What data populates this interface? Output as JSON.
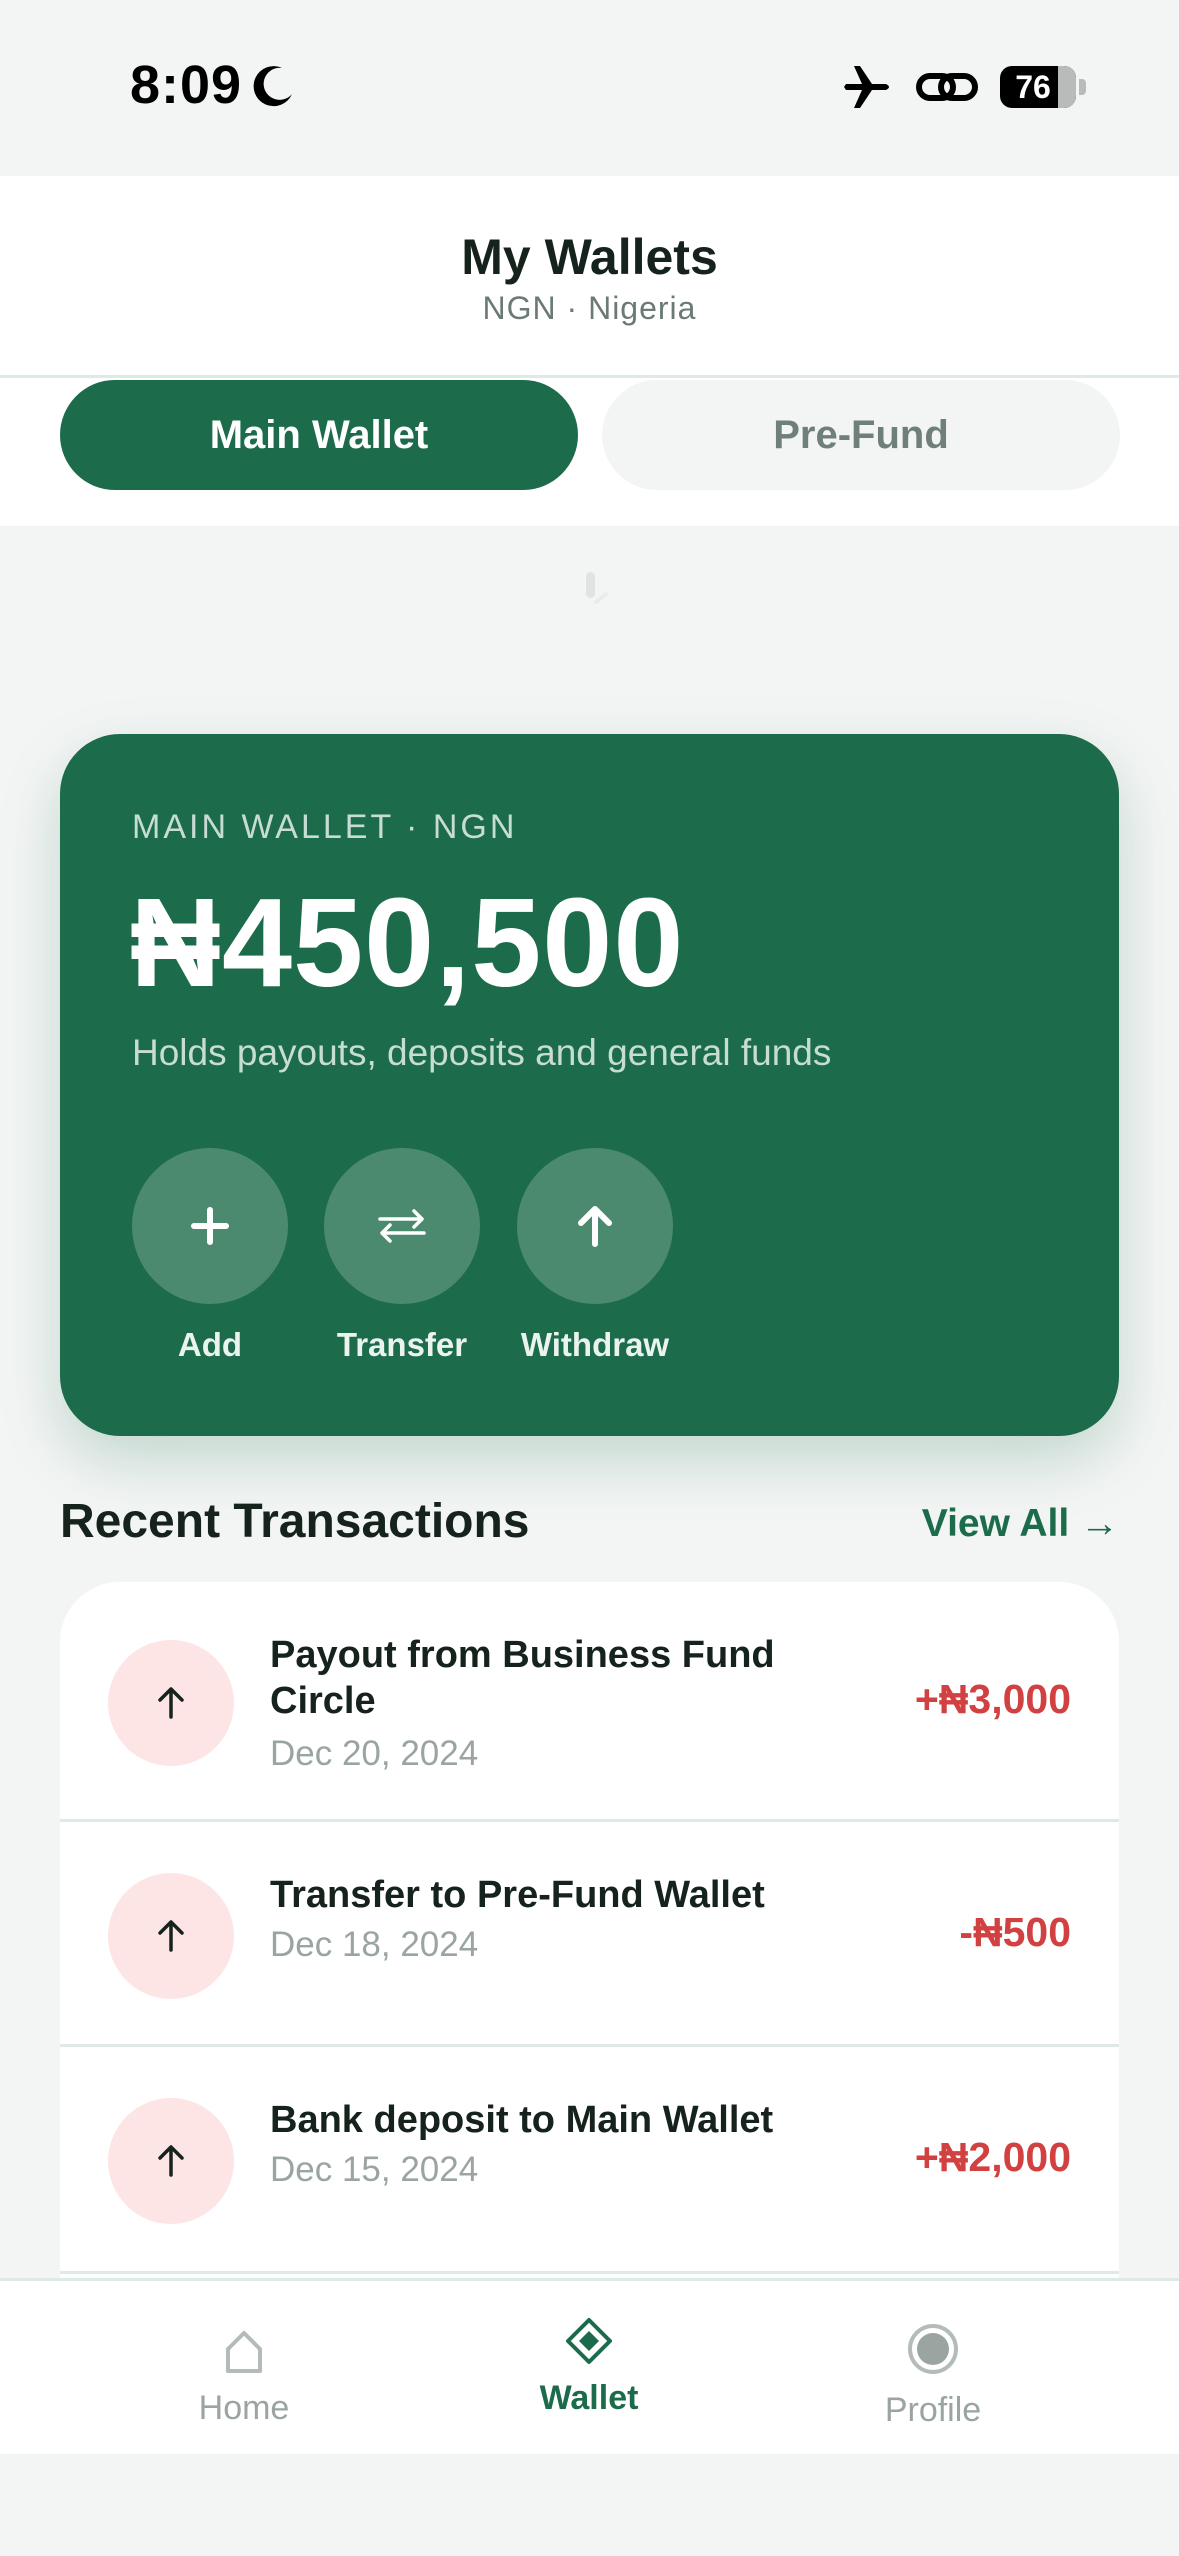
{
  "status_bar": {
    "time": "8:09",
    "battery": "76",
    "icons": [
      "moon-icon",
      "airplane-icon",
      "link-icon",
      "battery-icon"
    ]
  },
  "header": {
    "title": "My Wallets",
    "subtitle": "NGN · Nigeria"
  },
  "tabs": [
    {
      "label": "Main Wallet",
      "active": true
    },
    {
      "label": "Pre-Fund",
      "active": false
    }
  ],
  "wallet_card": {
    "label": "MAIN WALLET · NGN",
    "balance": "₦450,500",
    "description": "Holds payouts, deposits and general funds",
    "actions": [
      {
        "label": "Add",
        "icon": "plus-icon"
      },
      {
        "label": "Transfer",
        "icon": "transfer-arrows-icon"
      },
      {
        "label": "Withdraw",
        "icon": "arrow-up-icon"
      }
    ]
  },
  "recent": {
    "title": "Recent Transactions",
    "view_all": "View All →",
    "items": [
      {
        "title": "Payout from Business Fund Circle",
        "date": "Dec 20, 2024",
        "amount": "+₦3,000",
        "icon": "arrow-up-icon"
      },
      {
        "title": "Transfer to Pre-Fund Wallet",
        "date": "Dec 18, 2024",
        "amount": "-₦500",
        "icon": "arrow-up-icon"
      },
      {
        "title": "Bank deposit to Main Wallet",
        "date": "Dec 15, 2024",
        "amount": "+₦2,000",
        "icon": "arrow-up-icon"
      }
    ]
  },
  "nav": {
    "items": [
      {
        "label": "Home",
        "icon": "home-icon",
        "active": false
      },
      {
        "label": "Wallet",
        "icon": "diamond-icon",
        "active": true
      },
      {
        "label": "Profile",
        "icon": "profile-circle-icon",
        "active": false
      }
    ]
  },
  "colors": {
    "brand": "#1c6c4c",
    "negative": "#d24141",
    "icon_bg": "#fde5e5",
    "background": "#f3f5f4"
  }
}
